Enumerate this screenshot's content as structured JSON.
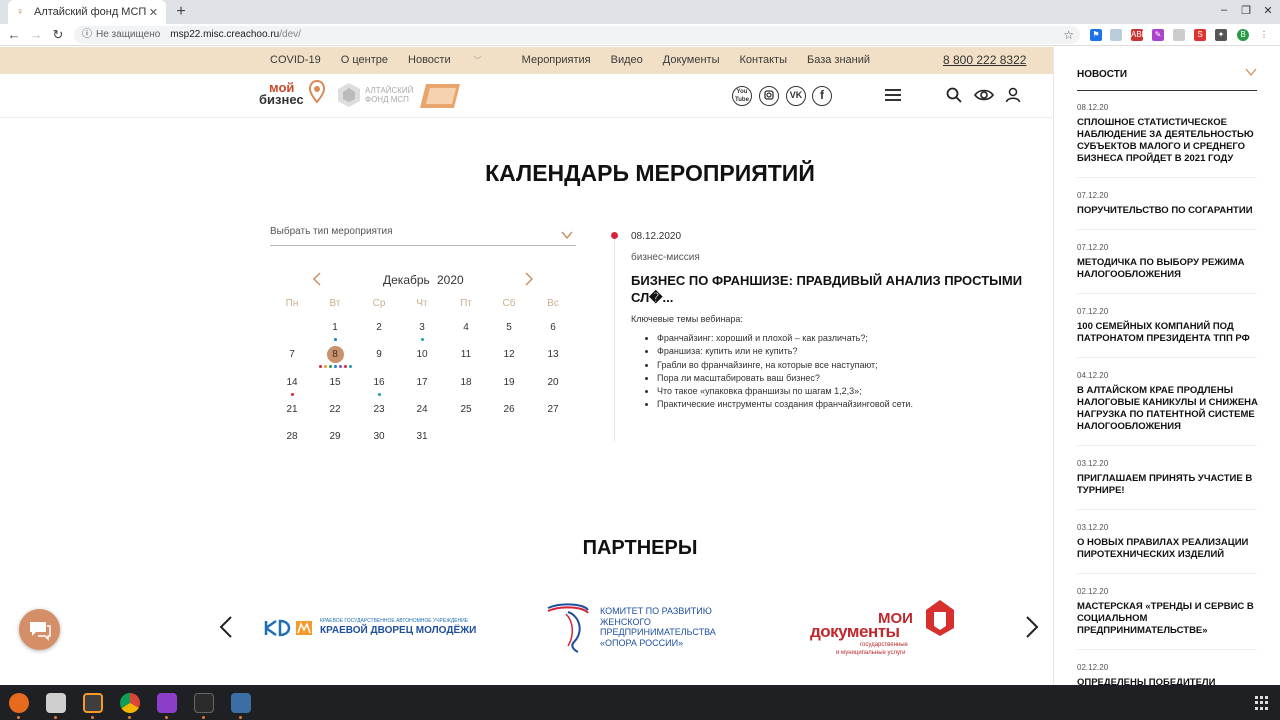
{
  "browser": {
    "tab_title": "Алтайский фонд МСП",
    "not_secure": "Не защищено",
    "url_host": "msp22.misc.creachoo.ru",
    "url_path": "/dev/"
  },
  "topnav": {
    "items": [
      "COVID-19",
      "О центре",
      "Новости",
      "Мероприятия",
      "Видео",
      "Документы",
      "Контакты",
      "База знаний"
    ],
    "phone": "8 800 222 8322"
  },
  "logos": {
    "moy_biznes_line1": "мой",
    "moy_biznes_line2": "бизнес",
    "fond_line1": "АЛТАЙСКИЙ",
    "fond_line2": "ФОНД МСП"
  },
  "social": [
    "You Tube",
    "IG",
    "VK",
    "f"
  ],
  "main": {
    "title": "КАЛЕНДАРЬ МЕРОПРИЯТИЙ",
    "select_placeholder": "Выбрать тип мероприятия"
  },
  "calendar": {
    "month": "Декабрь",
    "year": "2020",
    "weekdays": [
      "Пн",
      "Вт",
      "Ср",
      "Чт",
      "Пт",
      "Сб",
      "Вс"
    ],
    "selected_day": 8,
    "weeks": [
      [
        "",
        "1",
        "2",
        "3",
        "4",
        "5",
        "6"
      ],
      [
        "7",
        "8",
        "9",
        "10",
        "11",
        "12",
        "13"
      ],
      [
        "14",
        "15",
        "16",
        "17",
        "18",
        "19",
        "20"
      ],
      [
        "21",
        "22",
        "23",
        "24",
        "25",
        "26",
        "27"
      ],
      [
        "28",
        "29",
        "30",
        "31",
        "",
        "",
        ""
      ]
    ],
    "event_dot_colors": {
      "primary": "#1a7fc9",
      "red": "#d8243a",
      "teal": "#1aa3a3",
      "multi": [
        "#d8243a",
        "#e0a020",
        "#2a9a4a",
        "#1a7fc9",
        "#8a4ac9",
        "#d8243a",
        "#1aa3a3"
      ]
    }
  },
  "event": {
    "date": "08.12.2020",
    "type": "бизнес-миссия",
    "title": "БИЗНЕС ПО ФРАНШИЗЕ: ПРАВДИВЫЙ АНАЛИЗ ПРОСТЫМИ СЛ�...",
    "subtitle": "Ключевые темы вебинара:",
    "topics": [
      "Франчайзинг: хороший и плохой – как различать?;",
      "Франшиза: купить или не купить?",
      "Грабли во франчайзинге, на которые все наступают;",
      "Пора ли масштабировать ваш бизнес?",
      "Что такое «упаковка франшизы по шагам 1,2,3»;",
      "Практические инструменты создания франчайзинговой сети."
    ]
  },
  "partners": {
    "title": "ПАРТНЕРЫ",
    "p1_small": "КРАЕВОЕ ГОСУДАРСТВЕННОЕ АВТОНОМНОЕ УЧРЕЖДЕНИЕ",
    "p1_big": "КРАЕВОЙ ДВОРЕЦ МОЛОДЁЖИ",
    "p2_lines": [
      "КОМИТЕТ ПО РАЗВИТИЮ",
      "ЖЕНСКОГО",
      "ПРЕДПРИНИМАТЕЛЬСТВА",
      "«ОПОРА РОССИИ»"
    ],
    "p3_line1": "МОИ",
    "p3_line2": "документы",
    "p3_line3": "государственные",
    "p3_line4": "и муниципальные услуги"
  },
  "news": {
    "header": "НОВОСТИ",
    "items": [
      {
        "date": "08.12.20",
        "title": "СПЛОШНОЕ СТАТИСТИЧЕСКОЕ НАБЛЮДЕНИЕ ЗА ДЕЯТЕЛЬНОСТЬЮ СУБЪЕКТОВ МАЛОГО И СРЕДНЕГО БИЗНЕСА ПРОЙДЕТ В 2021 ГОДУ"
      },
      {
        "date": "07.12.20",
        "title": "ПОРУЧИТЕЛЬСТВО ПО СОГАРАНТИИ"
      },
      {
        "date": "07.12.20",
        "title": "МЕТОДИЧКА ПО ВЫБОРУ РЕЖИМА НАЛОГООБЛОЖЕНИЯ"
      },
      {
        "date": "07.12.20",
        "title": "100 СЕМЕЙНЫХ КОМПАНИЙ ПОД ПАТРОНАТОМ ПРЕЗИДЕНТА ТПП РФ"
      },
      {
        "date": "04.12.20",
        "title": "В АЛТАЙСКОМ КРАЕ ПРОДЛЕНЫ НАЛОГОВЫЕ КАНИКУЛЫ И СНИЖЕНА НАГРУЗКА ПО ПАТЕНТНОЙ СИСТЕМЕ НАЛОГООБЛОЖЕНИЯ"
      },
      {
        "date": "03.12.20",
        "title": "ПРИГЛАШАЕМ ПРИНЯТЬ УЧАСТИЕ В ТУРНИРЕ!"
      },
      {
        "date": "03.12.20",
        "title": "О НОВЫХ ПРАВИЛАХ РЕАЛИЗАЦИИ ПИРОТЕХНИЧЕСКИХ ИЗДЕЛИЙ"
      },
      {
        "date": "02.12.20",
        "title": "МАСТЕРСКАЯ «ТРЕНДЫ И СЕРВИС В СОЦИАЛЬНОМ ПРЕДПРИНИМАТЕЛЬСТВЕ»"
      },
      {
        "date": "02.12.20",
        "title": "ОПРЕДЕЛЕНЫ ПОБЕДИТЕЛИ КОНКУРСА"
      }
    ]
  },
  "colors": {
    "accent": "#c9926a",
    "topbar": "#f2e0c6",
    "event_marker": "#d8243a"
  }
}
